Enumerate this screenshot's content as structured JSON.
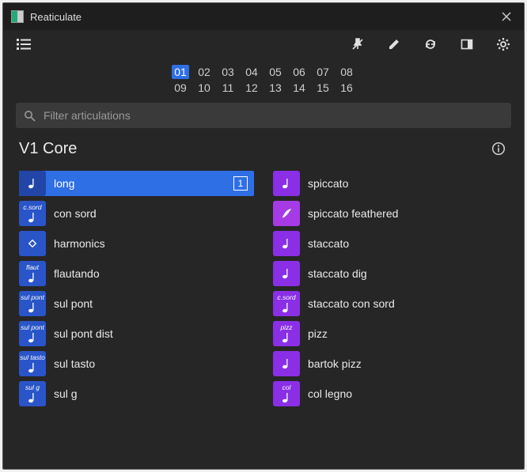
{
  "window": {
    "title": "Reaticulate"
  },
  "channels": {
    "row1": [
      "01",
      "02",
      "03",
      "04",
      "05",
      "06",
      "07",
      "08"
    ],
    "row2": [
      "09",
      "10",
      "11",
      "12",
      "13",
      "14",
      "15",
      "16"
    ],
    "active": "01"
  },
  "search": {
    "placeholder": "Filter articulations"
  },
  "section": {
    "title": "V1 Core"
  },
  "left": [
    {
      "label": "long",
      "chip_text": "",
      "selected": true,
      "badge": "1"
    },
    {
      "label": "con sord",
      "chip_text": "c.sord",
      "selected": false
    },
    {
      "label": "harmonics",
      "chip_text": "",
      "selected": false
    },
    {
      "label": "flautando",
      "chip_text": "flaut",
      "selected": false
    },
    {
      "label": "sul pont",
      "chip_text": "sul pont",
      "selected": false
    },
    {
      "label": "sul pont dist",
      "chip_text": "sul pont",
      "selected": false
    },
    {
      "label": "sul tasto",
      "chip_text": "sul tasto",
      "selected": false
    },
    {
      "label": "sul g",
      "chip_text": "sul g",
      "selected": false
    }
  ],
  "right": [
    {
      "label": "spiccato",
      "chip_text": "",
      "alt": false
    },
    {
      "label": "spiccato feathered",
      "chip_text": "",
      "alt": true
    },
    {
      "label": "staccato",
      "chip_text": "",
      "alt": false
    },
    {
      "label": "staccato dig",
      "chip_text": "",
      "alt": false
    },
    {
      "label": "staccato con sord",
      "chip_text": "c.sord",
      "alt": false
    },
    {
      "label": "pizz",
      "chip_text": "pizz",
      "alt": false
    },
    {
      "label": "bartok pizz",
      "chip_text": "",
      "alt": false
    },
    {
      "label": "col legno",
      "chip_text": "col",
      "alt": false
    }
  ]
}
